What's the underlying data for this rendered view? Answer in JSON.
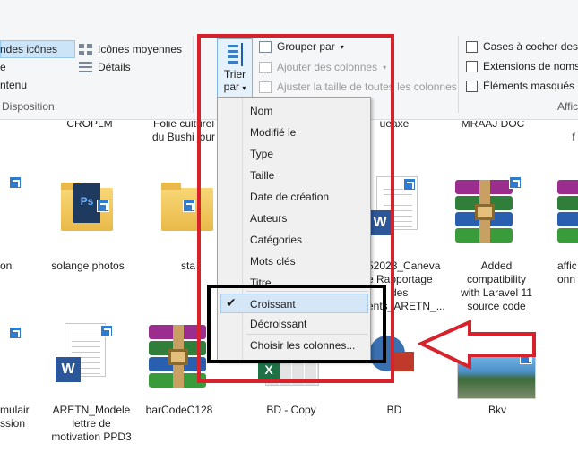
{
  "ribbon": {
    "layout_items": {
      "large_icons": "ndes icônes",
      "medium_icons": "Icônes moyennes",
      "list": "e",
      "details": "Détails",
      "content": "ntenu"
    },
    "layout_group_label": "Disposition",
    "sort_button_label_line1": "Trier",
    "sort_button_label_line2": "par",
    "group_by": "Grouper par",
    "add_columns": "Ajouter des colonnes",
    "fit_columns": "Ajuster la taille de toutes les colonnes",
    "checkboxes": {
      "item_checkboxes": "Cases à cocher des é",
      "file_extensions": "Extensions de noms",
      "hidden_items": "Éléments masqués"
    },
    "show_group_label": "Affic"
  },
  "sort_menu": {
    "items": [
      "Nom",
      "Modifié le",
      "Type",
      "Taille",
      "Date de création",
      "Auteurs",
      "Catégories",
      "Mots clés",
      "Titre"
    ],
    "ascending": "Croissant",
    "descending": "Décroissant",
    "choose_columns": "Choisir les colonnes...",
    "checked": "Croissant"
  },
  "files": {
    "top_row_partial": [
      "CROPLM",
      "Folie culturel",
      "du Bushi jour",
      "ueaxe",
      "MRAAJ DOC",
      "f"
    ],
    "row1": {
      "item0": "on",
      "item1": "solange photos",
      "item2": "sta",
      "item3_line1": "52023_Caneva",
      "item3_line2": "e Rapportage",
      "item3_line3": "des",
      "item3_line4": "ents_ARETN_...",
      "item4_line1": "Added",
      "item4_line2": "compatibility",
      "item4_line3": "with Laravel 11",
      "item4_line4": "source code",
      "item5_line1": "affic",
      "item5_line2": "onn"
    },
    "row2": {
      "item0_line1": "mulair",
      "item0_line2": "ssion",
      "item1_line1": "ARETN_Modele",
      "item1_line2": "lettre de",
      "item1_line3": "motivation PPD3",
      "item2": "barCodeC128",
      "item3": "BD - Copy",
      "item4": "BD",
      "item5": "Bkv"
    }
  },
  "colors": {
    "annotation_red": "#d8222b",
    "annotation_black": "#000000",
    "selection_blue": "#cce4f7"
  }
}
